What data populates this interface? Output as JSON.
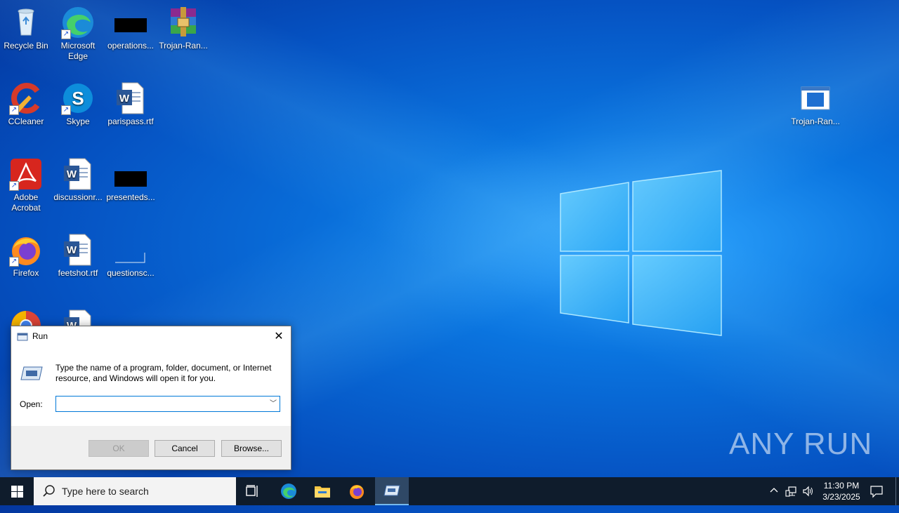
{
  "desktop": {
    "icons": [
      {
        "label": "Recycle Bin"
      },
      {
        "label": "Microsoft Edge"
      },
      {
        "label": "operations..."
      },
      {
        "label": "Trojan-Ran..."
      },
      {
        "label": "CCleaner"
      },
      {
        "label": "Skype"
      },
      {
        "label": "parispass.rtf"
      },
      {
        "label": "Adobe Acrobat"
      },
      {
        "label": "discussionr..."
      },
      {
        "label": "presenteds..."
      },
      {
        "label": "Firefox"
      },
      {
        "label": "feetshot.rtf"
      },
      {
        "label": "questionsc..."
      },
      {
        "label": "Trojan-Ran..."
      }
    ],
    "watermark": "ANY RUN"
  },
  "run_dialog": {
    "title": "Run",
    "description": "Type the name of a program, folder, document, or Internet resource, and Windows will open it for you.",
    "open_label": "Open:",
    "open_value": "",
    "ok_label": "OK",
    "cancel_label": "Cancel",
    "browse_label": "Browse..."
  },
  "taskbar": {
    "search_placeholder": "Type here to search",
    "time": "11:30 PM",
    "date": "3/23/2025"
  },
  "colors": {
    "accent": "#0078d7",
    "taskbar": "#0f1c2c"
  }
}
